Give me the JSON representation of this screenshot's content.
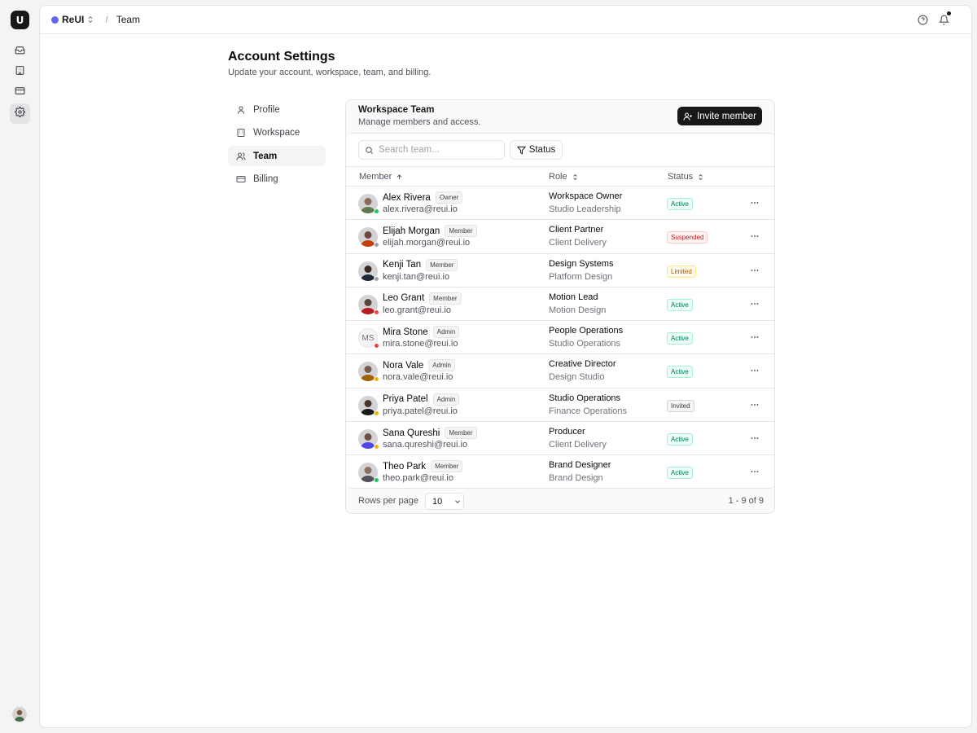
{
  "app": {
    "logo_letter": "U"
  },
  "topbar": {
    "workspace_name": "ReUI",
    "workspace_color": "#6366f1",
    "breadcrumb_current": "Team",
    "icons": [
      "help-circle-icon",
      "bell-icon"
    ]
  },
  "rail": {
    "items": [
      "inbox-icon",
      "building-icon",
      "credit-card-icon",
      "settings-icon"
    ],
    "active": "settings-icon"
  },
  "page": {
    "title": "Account Settings",
    "subtitle": "Update your account, workspace, team, and billing."
  },
  "nav": [
    {
      "label": "Profile",
      "icon": "user-icon"
    },
    {
      "label": "Workspace",
      "icon": "building-icon"
    },
    {
      "label": "Team",
      "icon": "users-icon",
      "active": true
    },
    {
      "label": "Billing",
      "icon": "credit-card-icon"
    }
  ],
  "card": {
    "title": "Workspace Team",
    "description": "Manage members and access.",
    "invite_label": "Invite member",
    "search_placeholder": "Search team...",
    "status_filter_label": "Status",
    "columns": {
      "member": "Member",
      "role": "Role",
      "status": "Status"
    },
    "rows": [
      {
        "name": "Alex Rivera",
        "tag": "Owner",
        "email": "alex.rivera@reui.io",
        "role": "Workspace Owner",
        "dept": "Studio Leadership",
        "status": "Active",
        "presence": "#22c55e"
      },
      {
        "name": "Elijah Morgan",
        "tag": "Member",
        "email": "elijah.morgan@reui.io",
        "role": "Client Partner",
        "dept": "Client Delivery",
        "status": "Suspended",
        "presence": "#a1a1aa"
      },
      {
        "name": "Kenji Tan",
        "tag": "Member",
        "email": "kenji.tan@reui.io",
        "role": "Design Systems",
        "dept": "Platform Design",
        "status": "Limited",
        "presence": "#a1a1aa"
      },
      {
        "name": "Leo Grant",
        "tag": "Member",
        "email": "leo.grant@reui.io",
        "role": "Motion Lead",
        "dept": "Motion Design",
        "status": "Active",
        "presence": "#ef4444"
      },
      {
        "name": "Mira Stone",
        "tag": "Admin",
        "email": "mira.stone@reui.io",
        "role": "People Operations",
        "dept": "Studio Operations",
        "status": "Active",
        "presence": "#ef4444",
        "initials": "MS"
      },
      {
        "name": "Nora Vale",
        "tag": "Admin",
        "email": "nora.vale@reui.io",
        "role": "Creative Director",
        "dept": "Design Studio",
        "status": "Active",
        "presence": "#eab308"
      },
      {
        "name": "Priya Patel",
        "tag": "Admin",
        "email": "priya.patel@reui.io",
        "role": "Studio Operations",
        "dept": "Finance Operations",
        "status": "Invited",
        "presence": "#eab308"
      },
      {
        "name": "Sana Qureshi",
        "tag": "Member",
        "email": "sana.qureshi@reui.io",
        "role": "Producer",
        "dept": "Client Delivery",
        "status": "Active",
        "presence": "#eab308"
      },
      {
        "name": "Theo Park",
        "tag": "Member",
        "email": "theo.park@reui.io",
        "role": "Brand Designer",
        "dept": "Brand Design",
        "status": "Active",
        "presence": "#22c55e"
      }
    ],
    "footer": {
      "rows_per_page_label": "Rows per page",
      "rows_per_page_value": "10",
      "range": "1 - 9 of 9"
    }
  },
  "status_colors": {
    "Active": {
      "bg": "#ecfdf5",
      "border": "#a7f3d0",
      "text": "#047857"
    },
    "Suspended": {
      "bg": "#fef2f2",
      "border": "#fecaca",
      "text": "#b91c1c"
    },
    "Limited": {
      "bg": "#fffbeb",
      "border": "#fde68a",
      "text": "#b45309"
    },
    "Invited": {
      "bg": "#f4f4f5",
      "border": "#d4d4d8",
      "text": "#3f3f46"
    }
  }
}
